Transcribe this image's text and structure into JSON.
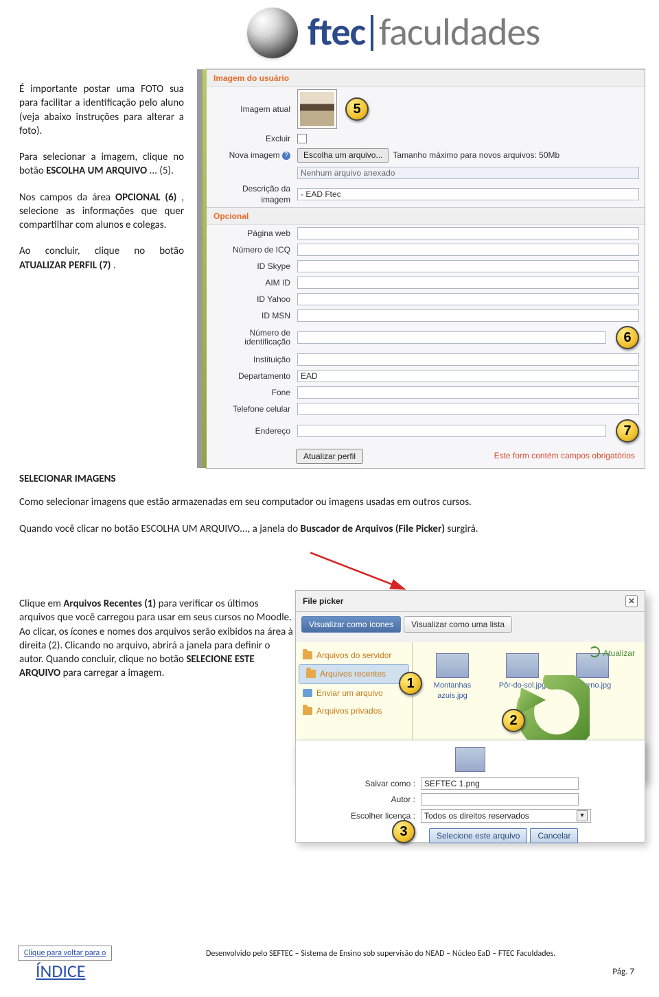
{
  "logo": {
    "brand": "ftec",
    "sub": "faculdades"
  },
  "left1": {
    "p1a": "É importante postar uma FOTO sua para facilitar a identificação pelo aluno (veja abaixo instruções para alterar a foto).",
    "p2": "Para selecionar a imagem, clique no botão ",
    "p2b": "ESCOLHA UM ARQUIVO",
    "p2c": "... (5).",
    "p3a": "Nos campos da área ",
    "p3b": "OPCIONAL (6)",
    "p3c": ", selecione as informações que quer compartilhar com alunos e colegas.",
    "p4a": "Ao concluir, clique no botão ",
    "p4b": "ATUALIZAR PERFIL (7)",
    "p4c": "."
  },
  "shot1": {
    "head1": "Imagem do usuário",
    "labels": {
      "imagem_atual": "Imagem atual",
      "excluir": "Excluir",
      "nova_imagem": "Nova imagem",
      "btn_file": "Escolha um arquivo...",
      "file_hint": "Tamanho máximo para novos arquivos: 50Mb",
      "nenhum": "Nenhum arquivo anexado",
      "descricao": "Descrição da imagem",
      "desc_val": "- EAD Ftec"
    },
    "head2": "Opcional",
    "opts": [
      "Página web",
      "Número de ICQ",
      "ID Skype",
      "AIM ID",
      "ID Yahoo",
      "ID MSN",
      "Número de identificação",
      "Instituição",
      "Departamento",
      "Fone",
      "Telefone celular",
      "Endereço"
    ],
    "dept_val": "EAD",
    "btn_update": "Atualizar perfil",
    "req": "Este form contém campos obrigatórios"
  },
  "callouts": {
    "c5": "5",
    "c6": "6",
    "c7": "7",
    "c1": "1",
    "c2": "2",
    "c3": "3"
  },
  "mid": {
    "h": "SELECIONAR IMAGENS",
    "p1": "Como selecionar imagens que estão armazenadas em seu computador ou imagens usadas em outros cursos.",
    "p2a": "Quando você clicar no botão ESCOLHA UM ARQUIVO..., a janela do ",
    "p2b": "Buscador de Arquivos (File Picker)",
    "p2c": " surgirá."
  },
  "left2": {
    "t1": "Clique em ",
    "t2": "Arquivos Recentes (1)",
    "t3": " para verificar os últimos arquivos que você carregou para usar em seus cursos no Moodle. Ao clicar, os ícones e nomes dos arquivos serão exibidos na área à direita (2). Clicando no arquivo, abrirá a janela para definir o autor. Quando concluir, clique no botão ",
    "t4": "SELECIONE ESTE ARQUIVO",
    "t5": " para carregar a imagem."
  },
  "filepicker": {
    "title": "File picker",
    "side": [
      "Arquivos do servidor",
      "Arquivos recentes",
      "Enviar um arquivo",
      "Arquivos privados"
    ],
    "tab_icons": "Visualizar como ícones",
    "tab_list": "Visualizar como uma lista",
    "refresh": "Atualizar",
    "thumbs": [
      "Montanhas azuis.jpg",
      "Pôr-do-sol.jpg",
      "Inverno.jpg"
    ]
  },
  "detail": {
    "save_as_l": "Salvar como :",
    "save_as_v": "SEFTEC 1.png",
    "author_l": "Autor :",
    "license_l": "Escolher licença :",
    "license_v": "Todos os direitos reservados",
    "btn_select": "Selecione este arquivo",
    "btn_cancel": "Cancelar"
  },
  "footer": {
    "back": "Clique para voltar para o",
    "indice": "ÍNDICE",
    "credit": "Desenvolvido pelo SEFTEC – Sistema de Ensino sob supervisão do NEAD – Núcleo EaD – FTEC Faculdades.",
    "page": "Pág. 7"
  }
}
